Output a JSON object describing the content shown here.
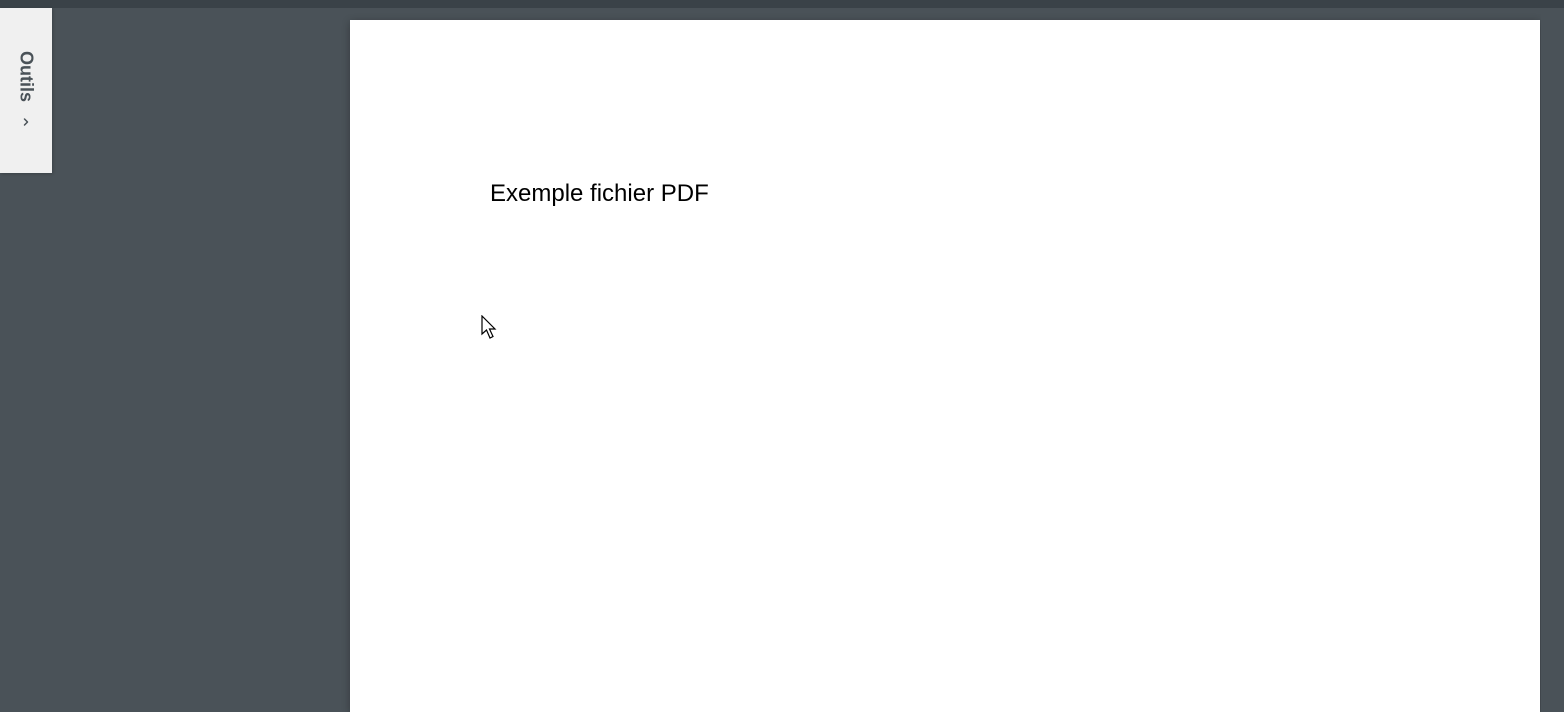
{
  "sidebar": {
    "tools_label": "Outils"
  },
  "document": {
    "title": "Exemple fichier PDF"
  }
}
